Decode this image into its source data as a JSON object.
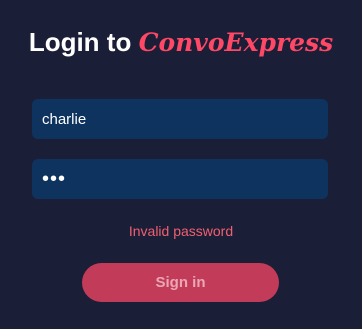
{
  "header": {
    "title_prefix": "Login to",
    "brand_name": "ConvoExpress"
  },
  "form": {
    "username_value": "charlie",
    "password_value": "•••",
    "error_message": "Invalid password",
    "submit_label": "Sign in"
  },
  "colors": {
    "background": "#1b1e37",
    "brand": "#ff4766",
    "input_background": "#0e335f",
    "error": "#f06070",
    "button": "#c23c59",
    "button_text": "#eaa6b4"
  }
}
